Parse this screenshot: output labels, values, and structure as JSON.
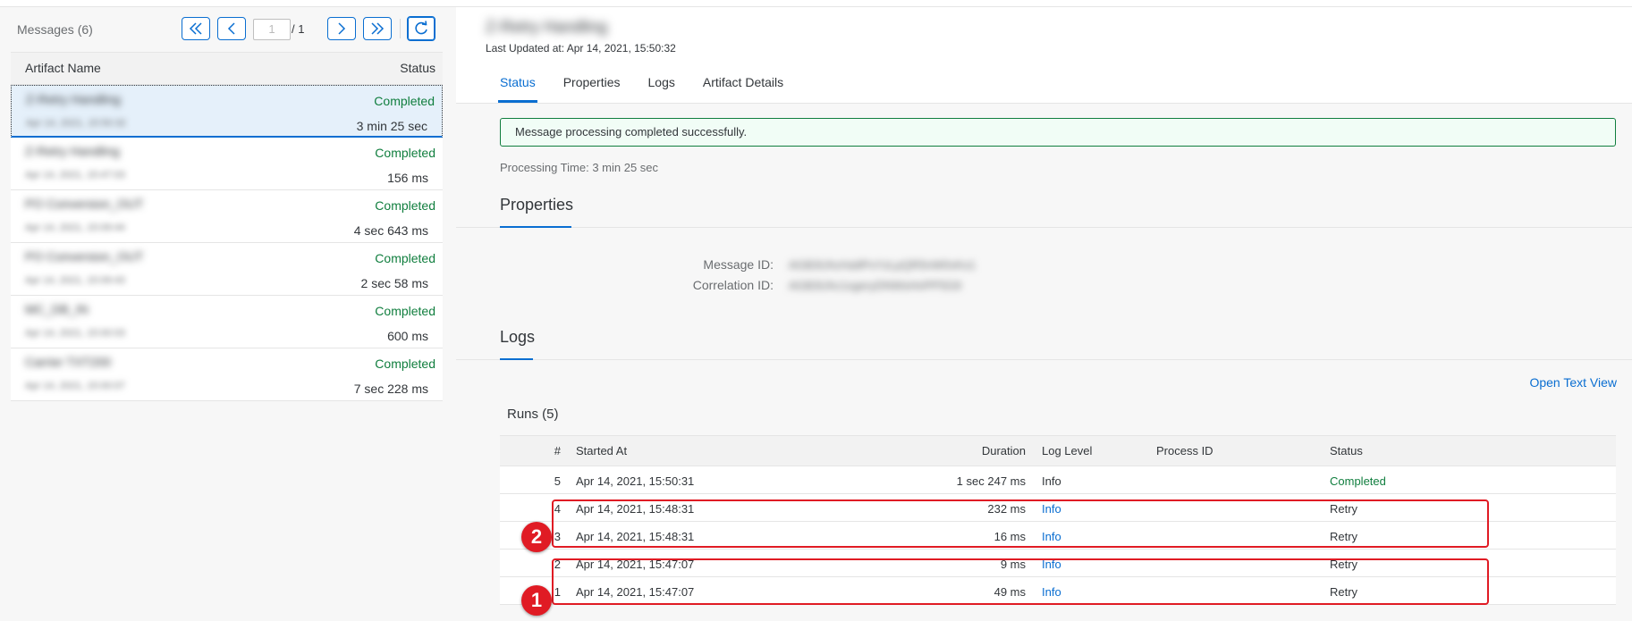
{
  "master": {
    "title": "Messages (6)",
    "page_current": "1",
    "page_of": "/ 1",
    "col_name": "Artifact Name",
    "col_status": "Status",
    "items": [
      {
        "name": "Z-Retry Handling",
        "date": "Apr 14, 2021, 15:50:32",
        "status": "Completed",
        "duration": "3 min 25 sec"
      },
      {
        "name": "Z-Retry Handling",
        "date": "Apr 14, 2021, 15:47:03",
        "status": "Completed",
        "duration": "156 ms"
      },
      {
        "name": "PO Conversion_OUT",
        "date": "Apr 14, 2021, 15:09:44",
        "status": "Completed",
        "duration": "4 sec 643 ms"
      },
      {
        "name": "PO Conversion_OUT",
        "date": "Apr 14, 2021, 15:09:43",
        "status": "Completed",
        "duration": "2 sec 58 ms"
      },
      {
        "name": "MC_DB_IN",
        "date": "Apr 14, 2021, 15:00:03",
        "status": "Completed",
        "duration": "600 ms"
      },
      {
        "name": "Carrier TXT200",
        "date": "Apr 14, 2021, 15:00:07",
        "status": "Completed",
        "duration": "7 sec 228 ms"
      }
    ]
  },
  "detail": {
    "artifact_title": "Z-Retry Handling",
    "last_updated": "Last Updated at: Apr 14, 2021, 15:50:32",
    "tabs": [
      "Status",
      "Properties",
      "Logs",
      "Artifact Details"
    ],
    "success_msg": "Message processing completed successfully.",
    "processing_time": "Processing Time: 3 min 25 sec",
    "properties_title": "Properties",
    "message_id_label": "Message ID:",
    "message_id_value": "AGB3UhcHa9PxYzLpQR5nW0vKs1",
    "correlation_id_label": "Correlation ID:",
    "correlation_id_value": "AGB3Uhc1xgeryDNWsHnPP5G9",
    "logs_title": "Logs",
    "open_text_view": "Open Text View",
    "runs_title": "Runs (5)",
    "runs_headers": {
      "num": "#",
      "started": "Started At",
      "duration": "Duration",
      "level": "Log Level",
      "pid": "Process ID",
      "status": "Status"
    },
    "runs": [
      {
        "num": "5",
        "started": "Apr 14, 2021, 15:50:31",
        "duration": "1 sec 247 ms",
        "level": "Info",
        "pid": "",
        "status": "Completed"
      },
      {
        "num": "4",
        "started": "Apr 14, 2021, 15:48:31",
        "duration": "232 ms",
        "level": "Info",
        "pid": "",
        "status": "Retry"
      },
      {
        "num": "3",
        "started": "Apr 14, 2021, 15:48:31",
        "duration": "16 ms",
        "level": "Info",
        "pid": "",
        "status": "Retry"
      },
      {
        "num": "2",
        "started": "Apr 14, 2021, 15:47:07",
        "duration": "9 ms",
        "level": "Info",
        "pid": "",
        "status": "Retry"
      },
      {
        "num": "1",
        "started": "Apr 14, 2021, 15:47:07",
        "duration": "49 ms",
        "level": "Info",
        "pid": "",
        "status": "Retry"
      }
    ],
    "markers": [
      "2",
      "1"
    ]
  },
  "colors": {
    "accent": "#0a6ed1",
    "success": "#107e3e",
    "annotation": "#e01b24"
  }
}
